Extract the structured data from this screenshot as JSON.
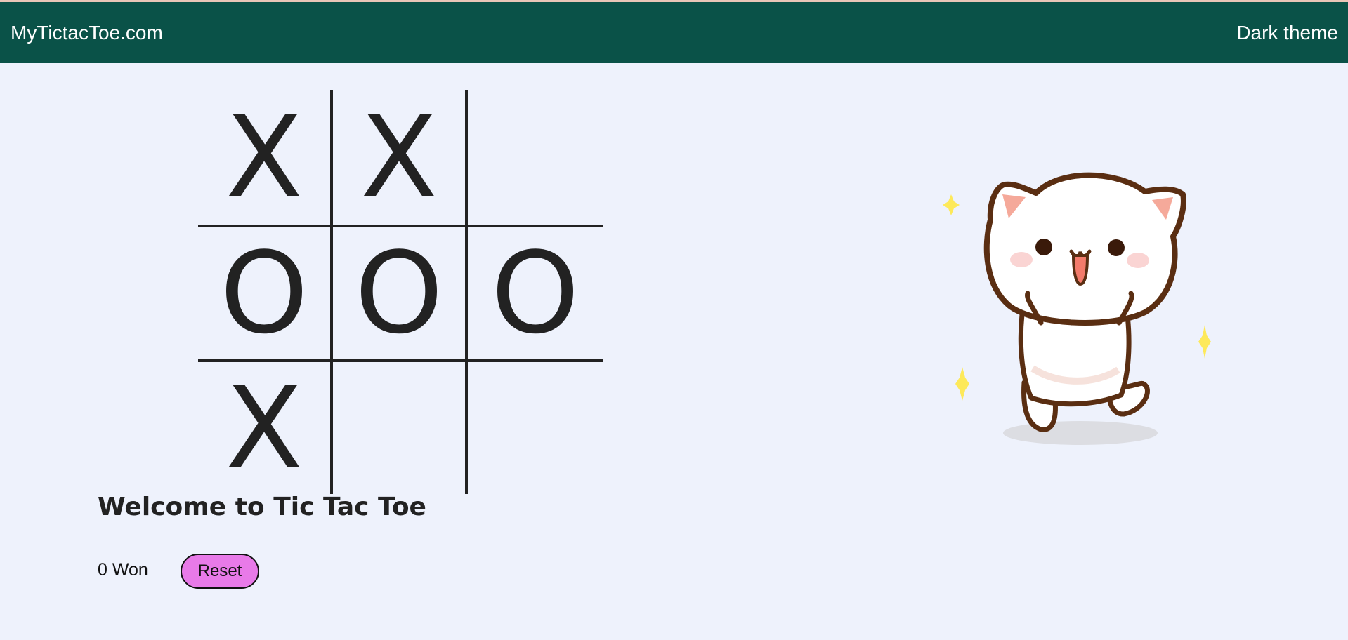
{
  "header": {
    "brand": "MyTictacToe.com",
    "theme_toggle": "Dark theme"
  },
  "board": {
    "cells": [
      "X",
      "X",
      "",
      "O",
      "O",
      "O",
      "X",
      "",
      ""
    ]
  },
  "main": {
    "welcome": "Welcome to Tic Tac Toe",
    "score": "0 Won",
    "reset_label": "Reset"
  },
  "colors": {
    "navbar": "#0a5248",
    "background": "#eef2fc",
    "reset_button": "#e87ae8"
  },
  "icons": {
    "mascot": "happy-cat-illustration",
    "sparkle": "sparkle-icon"
  }
}
